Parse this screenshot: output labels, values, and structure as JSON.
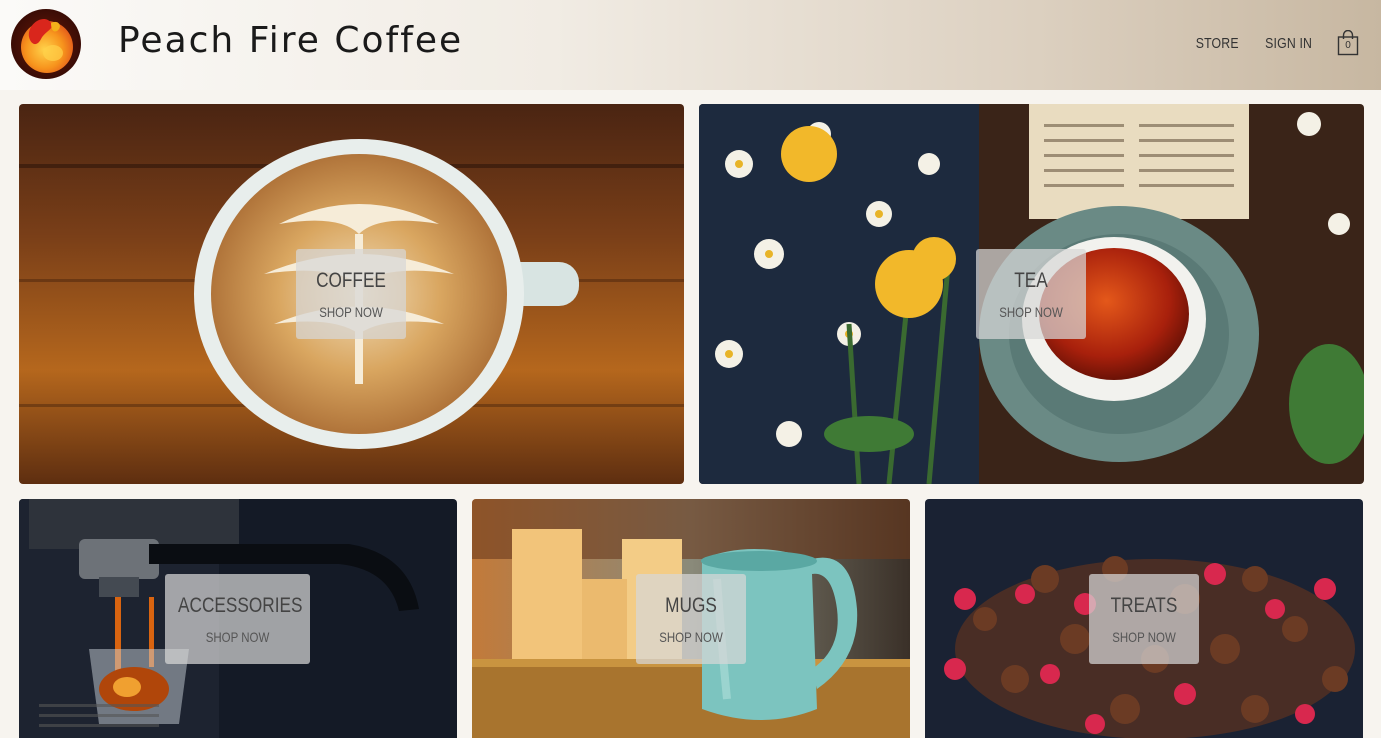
{
  "brand": {
    "name": "Peach Fire Coffee",
    "logo_icon": "peach-flame-logo-icon"
  },
  "nav": {
    "store": "STORE",
    "sign_in": "SIGN IN",
    "cart_icon": "shopping-bag-icon",
    "cart_count": "0"
  },
  "categories": [
    {
      "title": "COFFEE",
      "cta": "SHOP NOW",
      "image": "latte-art-cup-on-wood"
    },
    {
      "title": "TEA",
      "cta": "SHOP NOW",
      "image": "tea-cup-with-sunflowers-and-book"
    },
    {
      "title": "ACCESSORIES",
      "cta": "SHOP NOW",
      "image": "espresso-machine-pouring-shot"
    },
    {
      "title": "MUGS",
      "cta": "SHOP NOW",
      "image": "turquoise-ceramic-mug"
    },
    {
      "title": "TREATS",
      "cta": "SHOP NOW",
      "image": "chocolate-truffles-and-raspberries"
    }
  ],
  "colors": {
    "brand_peach": "#f28c1e",
    "brand_red": "#d9261c"
  }
}
